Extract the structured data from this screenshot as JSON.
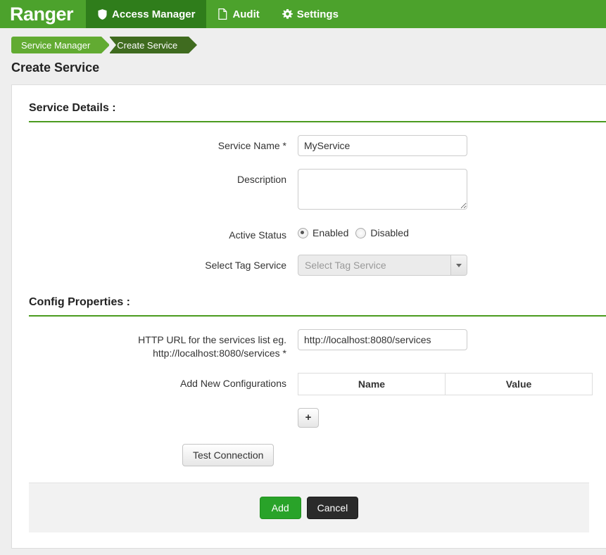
{
  "header": {
    "brand": "Ranger",
    "nav": [
      {
        "label": "Access Manager",
        "icon": "shield-icon",
        "active": true
      },
      {
        "label": "Audit",
        "icon": "document-icon",
        "active": false
      },
      {
        "label": "Settings",
        "icon": "gear-icon",
        "active": false
      }
    ]
  },
  "breadcrumb": {
    "items": [
      {
        "label": "Service Manager"
      },
      {
        "label": "Create Service"
      }
    ]
  },
  "page": {
    "title": "Create Service"
  },
  "service_details": {
    "heading": "Service Details :",
    "service_name": {
      "label": "Service Name *",
      "value": "MyService",
      "placeholder": ""
    },
    "description": {
      "label": "Description",
      "value": "",
      "placeholder": ""
    },
    "active_status": {
      "label": "Active Status",
      "options": [
        "Enabled",
        "Disabled"
      ],
      "selected": "Enabled"
    },
    "tag_service": {
      "label": "Select Tag Service",
      "placeholder": "Select Tag Service",
      "value": ""
    }
  },
  "config_properties": {
    "heading": "Config Properties :",
    "http_url": {
      "label_line1": "HTTP URL for the services list eg.",
      "label_line2": "http://localhost:8080/services *",
      "value": "http://localhost:8080/services",
      "placeholder": ""
    },
    "add_new_configurations": {
      "label": "Add New Configurations",
      "columns": [
        "Name",
        "Value"
      ],
      "rows": []
    },
    "add_row_button": "+",
    "test_connection_button": "Test Connection"
  },
  "footer": {
    "add_button": "Add",
    "cancel_button": "Cancel"
  },
  "colors": {
    "brand_green": "#4ca22c",
    "active_tab_green": "#2f7d1b",
    "crumb_green": "#62ab32",
    "crumb_dark_green": "#3f6b1f",
    "section_rule_green": "#4b9b1f",
    "add_button_green": "#29a329",
    "cancel_button_dark": "#2b2b2b",
    "page_background": "#eeeeee"
  }
}
